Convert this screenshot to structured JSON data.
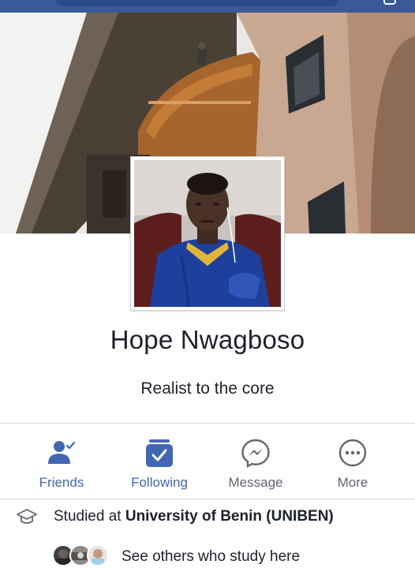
{
  "profile": {
    "name": "Hope Nwagboso",
    "bio": "Realist to the core"
  },
  "actions": {
    "friends_label": "Friends",
    "following_label": "Following",
    "message_label": "Message",
    "more_label": "More"
  },
  "education": {
    "prefix": "Studied at ",
    "school": "University of Benin (UNIBEN)"
  },
  "classmates": {
    "label": "See others who study here"
  },
  "icons": {
    "friends": "friend-check-icon",
    "following": "following-check-icon",
    "message": "messenger-icon",
    "more": "more-dots-icon",
    "education": "graduation-cap-icon"
  },
  "colors": {
    "accent": "#4267b2",
    "secondary_text": "#606770",
    "primary_text": "#1d2129",
    "topbar": "#3b5998"
  }
}
